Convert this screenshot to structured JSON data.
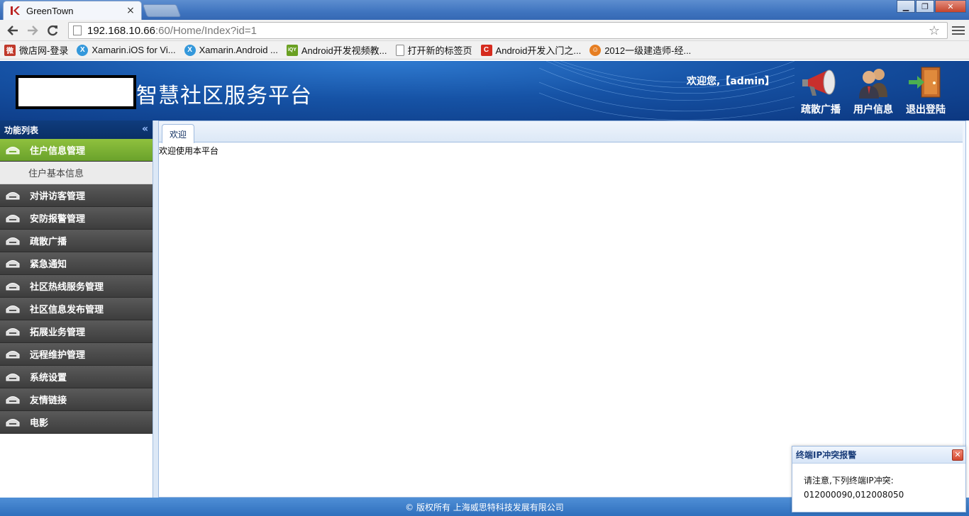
{
  "browser": {
    "tab_title": "GreenTown",
    "url_host": "192.168.10.66",
    "url_rest": ":60/Home/Index?id=1",
    "bookmarks": [
      {
        "label": "微店网-登录",
        "icon": "weidian-icon",
        "color": "#c0392b"
      },
      {
        "label": "Xamarin.iOS for Vi...",
        "icon": "xamarin-icon",
        "color": "#3498db"
      },
      {
        "label": "Xamarin.Android ...",
        "icon": "xamarin-icon",
        "color": "#3498db"
      },
      {
        "label": "Android开发视频教...",
        "icon": "iqiyi-icon",
        "color": "#6aa022"
      },
      {
        "label": "打开新的标签页",
        "icon": "page-icon",
        "color": "#ffffff"
      },
      {
        "label": "Android开发入门之...",
        "icon": "c-logo-icon",
        "color": "#d52b1e"
      },
      {
        "label": "2012一级建造师-经...",
        "icon": "face-icon",
        "color": "#e67e22"
      }
    ]
  },
  "header": {
    "title": "智慧社区服务平台",
    "welcome": "欢迎您,【admin】",
    "actions": [
      {
        "label": "疏散广播",
        "icon": "megaphone-icon"
      },
      {
        "label": "用户信息",
        "icon": "users-icon"
      },
      {
        "label": "退出登陆",
        "icon": "exit-door-icon"
      }
    ]
  },
  "sidebar": {
    "title": "功能列表",
    "active": "住户信息管理",
    "sub_item": "住户基本信息",
    "items": [
      "对讲访客管理",
      "安防报警管理",
      "疏散广播",
      "紧急通知",
      "社区热线服务管理",
      "社区信息发布管理",
      "拓展业务管理",
      "远程维护管理",
      "系统设置",
      "友情链接",
      "电影"
    ]
  },
  "content": {
    "tab_label": "欢迎",
    "text": "欢迎使用本平台"
  },
  "footer": {
    "text": "© 版权所有 上海威思特科技发展有限公司"
  },
  "popup": {
    "title": "终端IP冲突报警",
    "line1": "请注意,下列终端IP冲突:",
    "line2": "012000090,012008050"
  },
  "colors": {
    "header_blue": "#1653a6",
    "active_green": "#7ab236",
    "menu_dark": "#4a4a4a",
    "footer_blue": "#3f7fca"
  }
}
